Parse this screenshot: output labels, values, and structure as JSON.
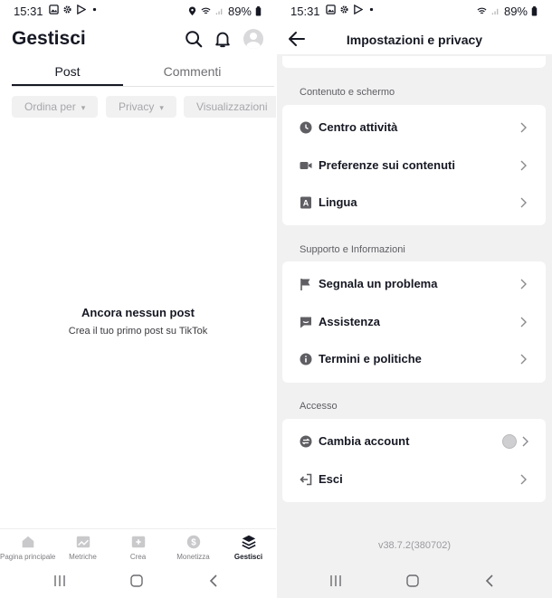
{
  "left": {
    "status": {
      "time": "15:31",
      "battery": "89%"
    },
    "title": "Gestisci",
    "tabs": {
      "post": "Post",
      "comments": "Commenti"
    },
    "filters": [
      "Ordina per",
      "Privacy",
      "Visualizzazioni"
    ],
    "empty": {
      "title": "Ancora nessun post",
      "subtitle": "Crea il tuo primo post su TikTok"
    },
    "bottom_nav": [
      {
        "label": "Pagina principale",
        "icon": "home-icon"
      },
      {
        "label": "Metriche",
        "icon": "chart-icon"
      },
      {
        "label": "Crea",
        "icon": "create-icon"
      },
      {
        "label": "Monetizza",
        "icon": "dollar-icon"
      },
      {
        "label": "Gestisci",
        "icon": "layers-icon",
        "active": true
      }
    ]
  },
  "right": {
    "status": {
      "time": "15:31",
      "battery": "89%"
    },
    "title": "Impostazioni e privacy",
    "sections": [
      {
        "label": "Contenuto e schermo",
        "items": [
          {
            "label": "Centro attività",
            "icon": "clock-icon"
          },
          {
            "label": "Preferenze sui contenuti",
            "icon": "video-icon"
          },
          {
            "label": "Lingua",
            "icon": "language-icon"
          }
        ]
      },
      {
        "label": "Supporto e Informazioni",
        "items": [
          {
            "label": "Segnala un problema",
            "icon": "flag-icon"
          },
          {
            "label": "Assistenza",
            "icon": "chat-icon"
          },
          {
            "label": "Termini e politiche",
            "icon": "info-icon"
          }
        ]
      },
      {
        "label": "Accesso",
        "items": [
          {
            "label": "Cambia account",
            "icon": "switch-account-icon"
          },
          {
            "label": "Esci",
            "icon": "logout-icon"
          }
        ]
      }
    ],
    "version": "v38.7.2(380702)"
  }
}
